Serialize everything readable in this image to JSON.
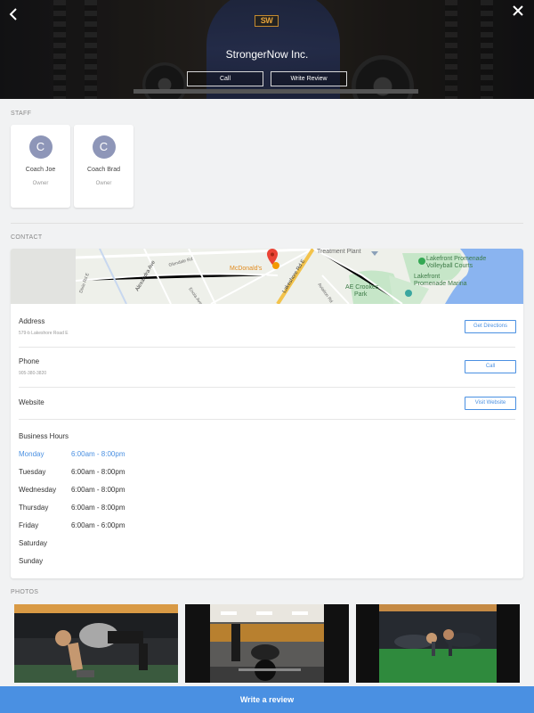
{
  "hero": {
    "logo_text": "SW",
    "business_name": "StrongerNow Inc.",
    "call_label": "Call",
    "write_review_label": "Write Review"
  },
  "staff": {
    "section_label": "STAFF",
    "members": [
      {
        "initial": "C",
        "name": "Coach Joe",
        "role": "Owner"
      },
      {
        "initial": "C",
        "name": "Coach Brad",
        "role": "Owner"
      }
    ]
  },
  "contact": {
    "section_label": "CONTACT",
    "map": {
      "labels": {
        "treatment_plant": "Treatment Plant",
        "lakefront_volleyball": "Lakefront Promenade Volleyball Courts",
        "lakefront_volleyball_l1": "Lakefront Promenade",
        "lakefront_volleyball_l2": "Volleyball Courts",
        "lakefront_marina_l1": "Lakefront",
        "lakefront_marina_l2": "Promenade Marina",
        "ae_crookes_l1": "AE Crookes",
        "ae_crookes_l2": "Park",
        "mcdonalds": "McDonald's",
        "lakeshore_rd": "Lakeshore Rd E",
        "alexandra_ave": "Alexandra Ave",
        "glendale_rd": "Glendale Rd",
        "enola_ave": "Enola Ave",
        "aviation_rd": "Aviation Rd",
        "dixie_rd": "Dixie Rd E"
      }
    },
    "address": {
      "title": "Address",
      "value": "579-b Lakeshore Road E",
      "button": "Get Directions"
    },
    "phone": {
      "title": "Phone",
      "value": "905-380-3820",
      "button": "Call"
    },
    "website": {
      "title": "Website",
      "button": "Visit Website"
    },
    "hours": {
      "title": "Business Hours",
      "days": [
        {
          "day": "Monday",
          "time": "6:00am - 8:00pm",
          "today": true
        },
        {
          "day": "Tuesday",
          "time": "6:00am - 8:00pm",
          "today": false
        },
        {
          "day": "Wednesday",
          "time": "6:00am - 8:00pm",
          "today": false
        },
        {
          "day": "Thursday",
          "time": "6:00am - 8:00pm",
          "today": false
        },
        {
          "day": "Friday",
          "time": "6:00am - 6:00pm",
          "today": false
        },
        {
          "day": "Saturday",
          "time": "",
          "today": false
        },
        {
          "day": "Sunday",
          "time": "",
          "today": false
        }
      ]
    }
  },
  "photos": {
    "section_label": "PHOTOS"
  },
  "footer": {
    "write_review_label": "Write a review"
  },
  "colors": {
    "accent": "#4a90e2",
    "avatar": "#8e96b8",
    "background": "#f1f2f3"
  }
}
